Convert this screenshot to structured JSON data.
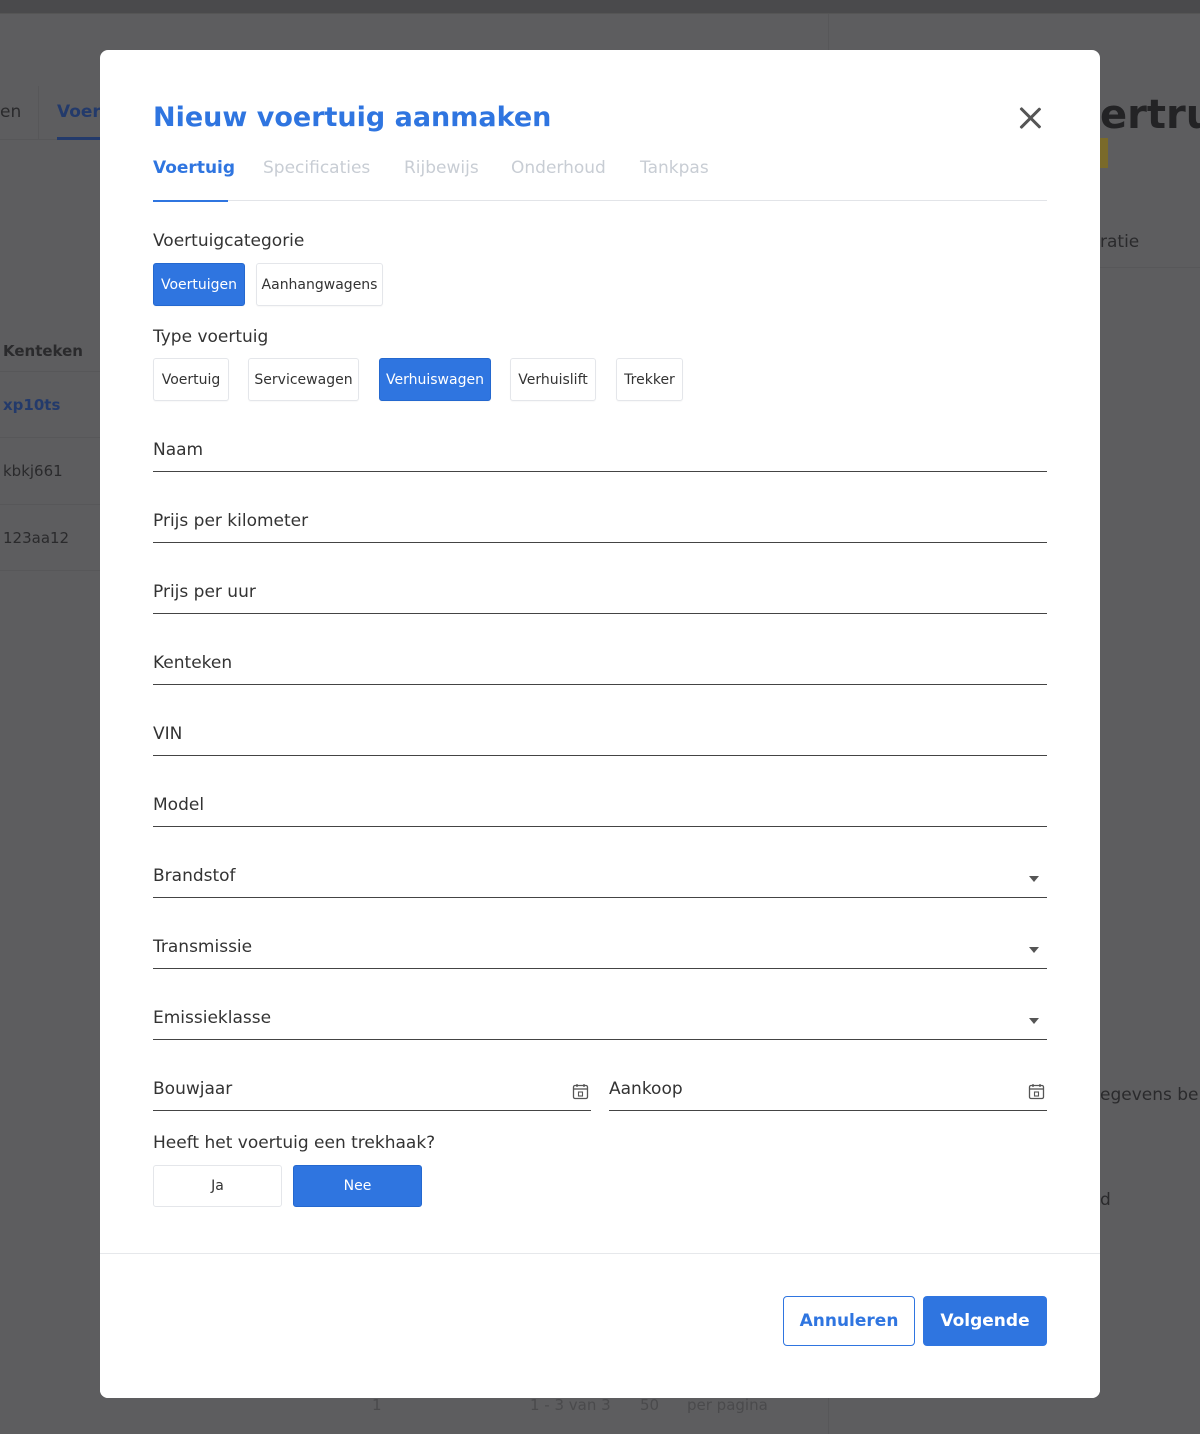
{
  "background": {
    "tab_left": "en",
    "tab_active": "Voer",
    "column_header": "Kenteken",
    "rows": [
      "xp10ts",
      "kbkj661",
      "123aa12"
    ],
    "right_title": "ertruc",
    "right_label": "ratie",
    "right_text": "egevens beke",
    "right_text2": "d",
    "pager": {
      "page": "1",
      "range": "1 - 3 van 3",
      "per_page_value": "50",
      "per_page_label": "per pagina"
    }
  },
  "modal": {
    "title": "Nieuw voertuig aanmaken",
    "tabs": [
      {
        "label": "Voertuig",
        "active": true
      },
      {
        "label": "Specificaties",
        "active": false
      },
      {
        "label": "Rijbewijs",
        "active": false
      },
      {
        "label": "Onderhoud",
        "active": false
      },
      {
        "label": "Tankpas",
        "active": false
      }
    ],
    "category": {
      "label": "Voertuigcategorie",
      "options": [
        "Voertuigen",
        "Aanhangwagens"
      ],
      "selected": "Voertuigen"
    },
    "type": {
      "label": "Type voertuig",
      "options": [
        "Voertuig",
        "Servicewagen",
        "Verhuiswagen",
        "Verhuislift",
        "Trekker"
      ],
      "selected": "Verhuiswagen"
    },
    "fields": {
      "naam": "Naam",
      "prijs_km": "Prijs per kilometer",
      "prijs_uur": "Prijs per uur",
      "kenteken": "Kenteken",
      "vin": "VIN",
      "model": "Model",
      "brandstof": "Brandstof",
      "transmissie": "Transmissie",
      "emissieklasse": "Emissieklasse",
      "bouwjaar": "Bouwjaar",
      "aankoop": "Aankoop"
    },
    "trekhaak": {
      "label": "Heeft het voertuig een trekhaak?",
      "yes": "Ja",
      "no": "Nee",
      "selected": "Nee"
    },
    "footer": {
      "cancel": "Annuleren",
      "next": "Volgende"
    }
  },
  "colors": {
    "accent": "#2f75e0",
    "overlay": "#5d5d5f",
    "inactive_tab": "#c8cdd4"
  }
}
